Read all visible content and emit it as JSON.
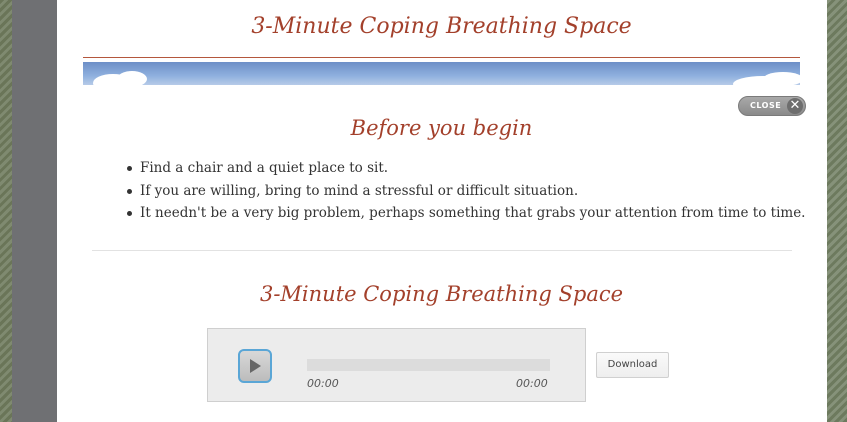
{
  "page_title": "3-Minute Coping Breathing Space",
  "close_button": {
    "label": "CLOSE",
    "icon": "close-icon"
  },
  "intro": {
    "heading": "Before you begin",
    "items": [
      "Find a chair and a quiet place to sit.",
      "If you are willing, bring to mind a stressful or difficult situation.",
      "It needn't be a very big problem, perhaps something that grabs your attention from time to time."
    ]
  },
  "audio": {
    "heading": "3-Minute Coping Breathing Space",
    "current_time": "00:00",
    "duration": "00:00",
    "progress": 0,
    "play_icon": "play-icon"
  },
  "download_label": "Download",
  "colors": {
    "heading": "#a3402b",
    "accent_border": "#5aa6d6",
    "background_stripe": "#6d7a5e"
  }
}
